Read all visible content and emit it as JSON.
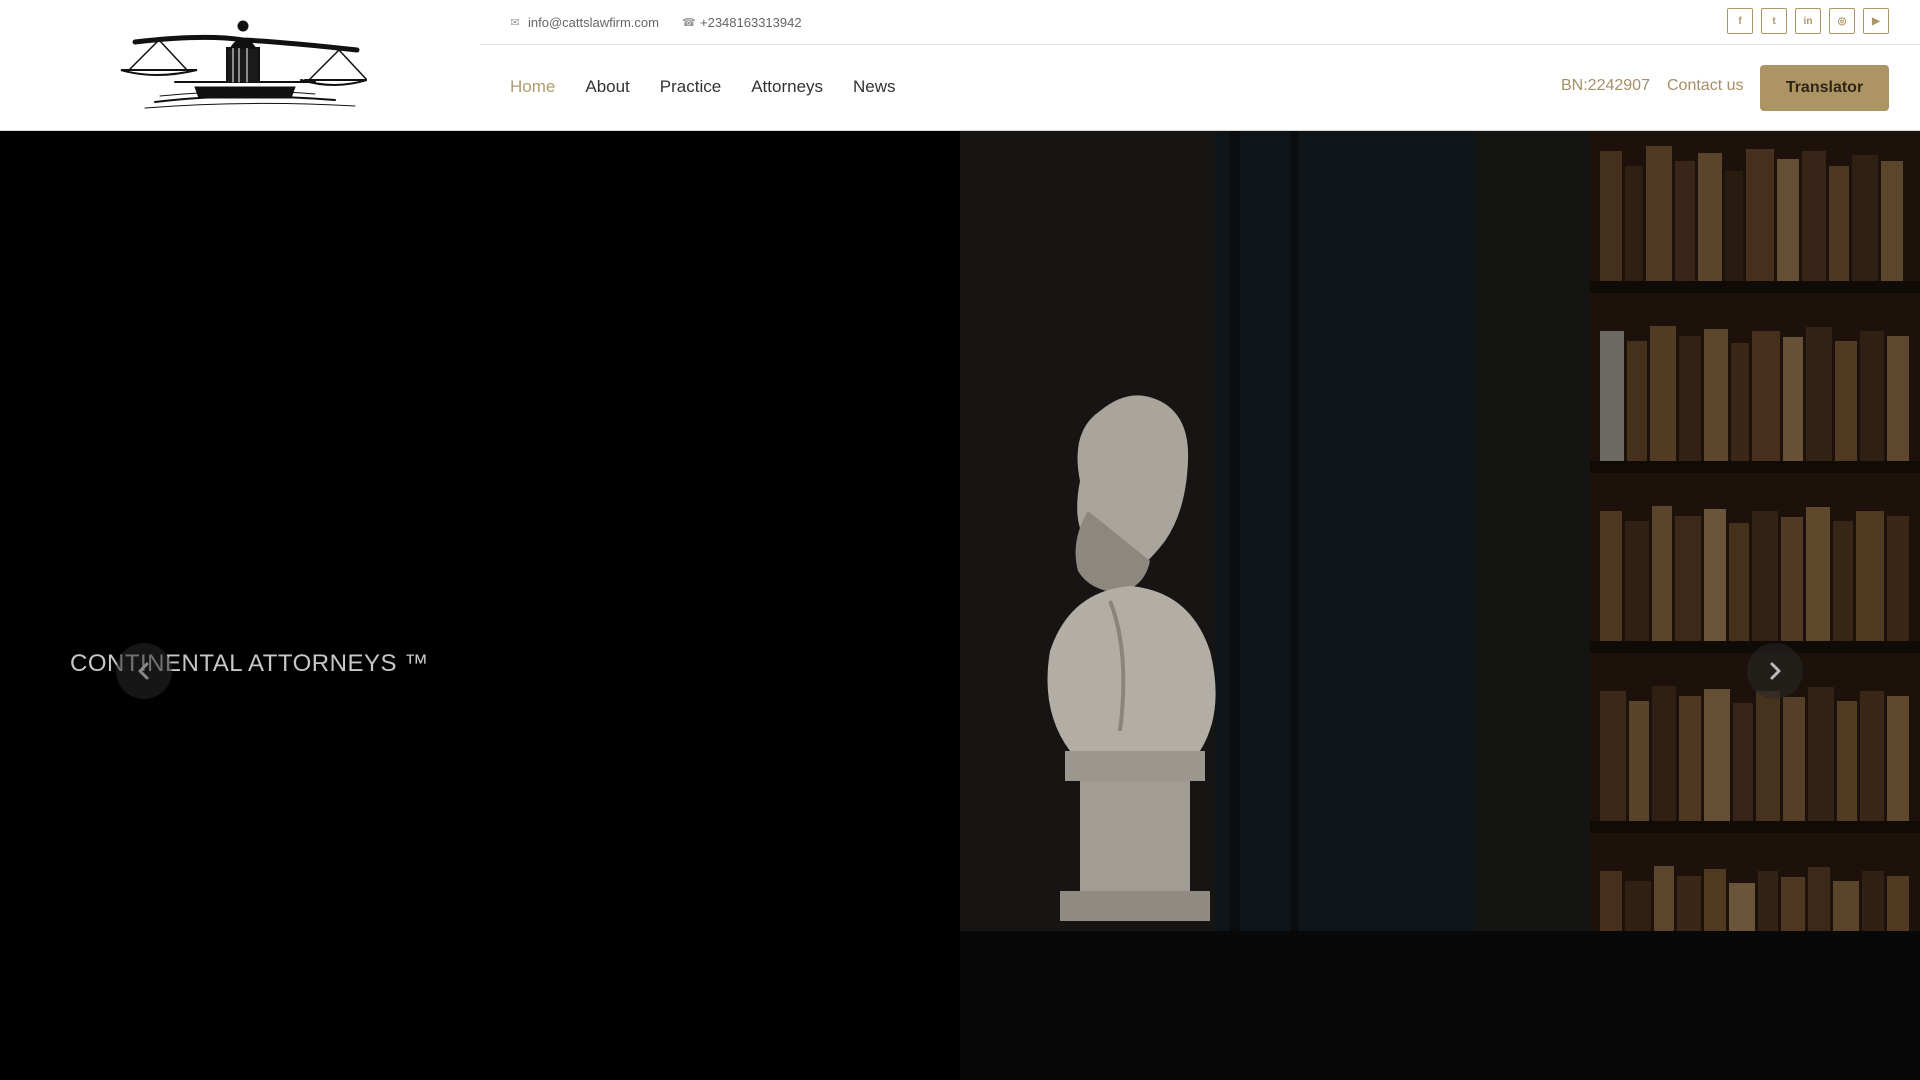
{
  "header": {
    "email": "info@cattslawfirm.com",
    "phone": "+2348163313942",
    "socials": [
      {
        "name": "facebook-icon",
        "glyph": "f"
      },
      {
        "name": "twitter-icon",
        "glyph": "t"
      },
      {
        "name": "linkedin-icon",
        "glyph": "in"
      },
      {
        "name": "instagram-icon",
        "glyph": "◎"
      },
      {
        "name": "youtube-icon",
        "glyph": "▶"
      }
    ],
    "nav": [
      {
        "label": "Home",
        "active": true
      },
      {
        "label": "About",
        "active": false
      },
      {
        "label": "Practice",
        "active": false
      },
      {
        "label": "Attorneys",
        "active": false
      },
      {
        "label": "News",
        "active": false
      }
    ],
    "bn": "BN:2242907",
    "contact_us": "Contact us",
    "translator": "Translator"
  },
  "hero": {
    "title": "CONTINENTAL ATTORNEYS ™"
  },
  "colors": {
    "accent": "#ad9465",
    "nav_active": "#b09b6f",
    "hero_bg": "#000000"
  }
}
